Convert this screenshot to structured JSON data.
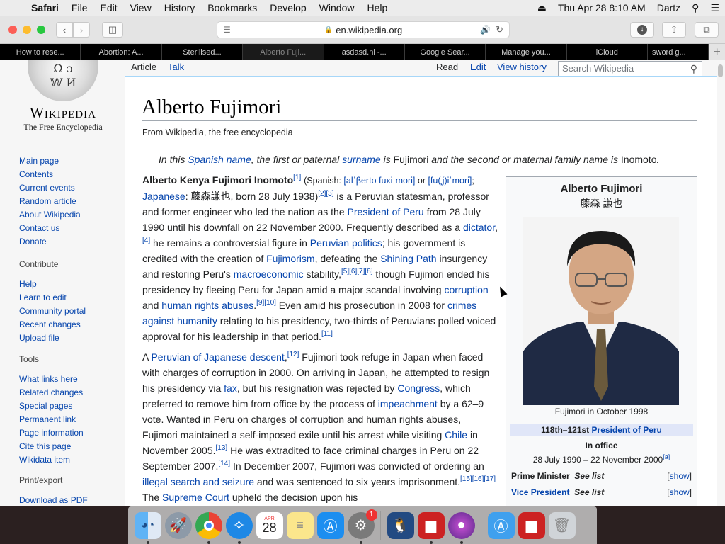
{
  "menubar": {
    "app": "Safari",
    "menus": [
      "File",
      "Edit",
      "View",
      "History",
      "Bookmarks",
      "Develop",
      "Window",
      "Help"
    ],
    "clock": "Thu Apr 28  8:10 AM",
    "user": "Dartz"
  },
  "toolbar": {
    "url": "en.wikipedia.org"
  },
  "tabs": [
    {
      "label": "How to rese..."
    },
    {
      "label": "Abortion: A..."
    },
    {
      "label": "Sterilised..."
    },
    {
      "label": "Alberto Fuji..."
    },
    {
      "label": "asdasd.nl -..."
    },
    {
      "label": "Google Sear..."
    },
    {
      "label": "Manage you..."
    },
    {
      "label": "iCloud"
    },
    {
      "label": "sword g..."
    }
  ],
  "logo": {
    "wordmark": "Wikipedia",
    "tagline": "The Free Encyclopedia"
  },
  "sidebar": {
    "main": [
      "Main page",
      "Contents",
      "Current events",
      "Random article",
      "About Wikipedia",
      "Contact us",
      "Donate"
    ],
    "contribute_heading": "Contribute",
    "contribute": [
      "Help",
      "Learn to edit",
      "Community portal",
      "Recent changes",
      "Upload file"
    ],
    "tools_heading": "Tools",
    "tools": [
      "What links here",
      "Related changes",
      "Special pages",
      "Permanent link",
      "Page information",
      "Cite this page",
      "Wikidata item"
    ],
    "print_heading": "Print/export",
    "print": [
      "Download as PDF"
    ]
  },
  "page_tabs": {
    "article": "Article",
    "talk": "Talk",
    "read": "Read",
    "edit": "Edit",
    "history": "View history",
    "search_placeholder": "Search Wikipedia"
  },
  "article": {
    "title": "Alberto Fujimori",
    "from": "From Wikipedia, the free encyclopedia"
  },
  "infobox": {
    "name": "Alberto Fujimori",
    "native": "藤森 謙也",
    "caption": "Fujimori in October 1998",
    "office_ordinal": "118th–121st",
    "office_link": "President of Peru",
    "in_office": "In office",
    "dates": "28 July 1990 – 22 November 2000",
    "dates_ref": "[a]",
    "pm_label": "Prime Minister",
    "pm_value": "See list",
    "vp_label": "Vice President",
    "vp_value": "See list",
    "show": "show"
  }
}
